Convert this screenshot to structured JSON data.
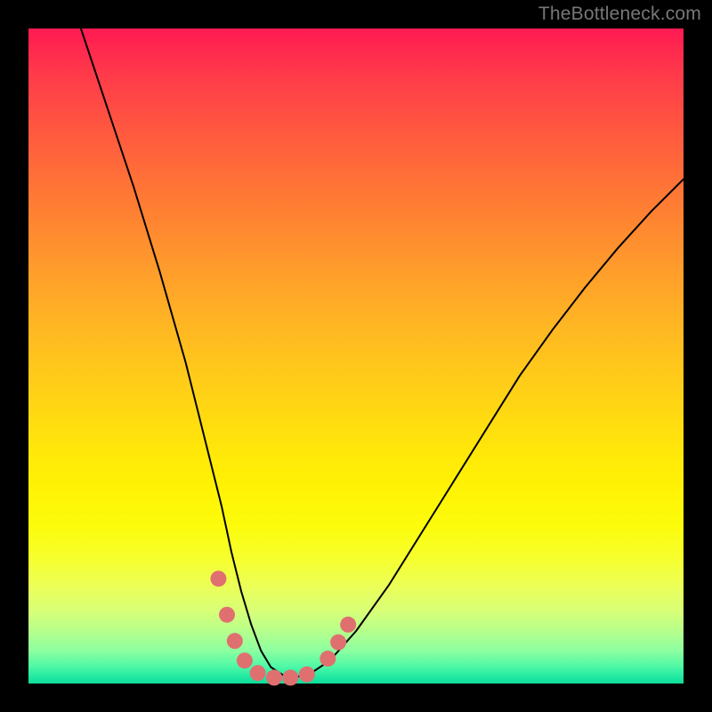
{
  "watermark": "TheBottleneck.com",
  "chart_data": {
    "type": "line",
    "title": "",
    "xlabel": "",
    "ylabel": "",
    "xlim": [
      0,
      100
    ],
    "ylim": [
      0,
      100
    ],
    "grid": false,
    "legend": false,
    "series": [
      {
        "name": "bottleneck-curve",
        "x": [
          8,
          12,
          16,
          20,
          24,
          27,
          29.5,
          31,
          32.5,
          34,
          35.5,
          37,
          39,
          41,
          43,
          46,
          50,
          55,
          60,
          65,
          70,
          75,
          80,
          85,
          90,
          95,
          100
        ],
        "y": [
          100,
          88,
          76,
          63,
          49,
          37,
          27,
          20,
          14,
          9,
          5,
          2.5,
          1.2,
          1.0,
          1.5,
          3.5,
          8,
          15,
          23,
          31,
          39,
          47,
          54,
          60.5,
          66.5,
          72,
          77
        ],
        "stroke": "#000000",
        "stroke_width": 2
      }
    ],
    "markers": {
      "name": "highlight-dots",
      "color": "#e07070",
      "radius": 9,
      "points": [
        {
          "x": 29.0,
          "y": 16.0
        },
        {
          "x": 30.3,
          "y": 10.5
        },
        {
          "x": 31.5,
          "y": 6.5
        },
        {
          "x": 33.0,
          "y": 3.5
        },
        {
          "x": 35.0,
          "y": 1.6
        },
        {
          "x": 37.5,
          "y": 0.9
        },
        {
          "x": 40.0,
          "y": 0.9
        },
        {
          "x": 42.5,
          "y": 1.4
        },
        {
          "x": 45.7,
          "y": 3.8
        },
        {
          "x": 47.3,
          "y": 6.3
        },
        {
          "x": 48.8,
          "y": 9.0
        }
      ]
    }
  },
  "colors": {
    "marker": "#e07070",
    "curve": "#000000",
    "background_frame": "#000000"
  }
}
